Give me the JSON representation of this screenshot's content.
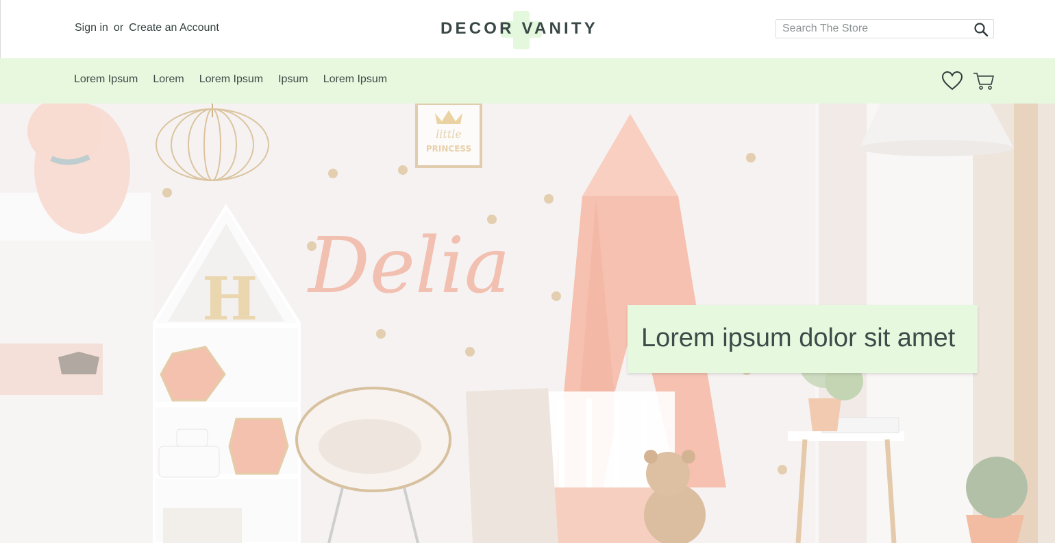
{
  "header": {
    "sign_in": "Sign in",
    "or": "or",
    "create_account": "Create an Account",
    "logo": "DECOR VANITY",
    "search_placeholder": "Search The Store"
  },
  "nav": {
    "items": [
      "Lorem Ipsum",
      "Lorem",
      "Lorem Ipsum",
      "Ipsum",
      "Lorem Ipsum"
    ],
    "icons": [
      "heart-icon",
      "cart-icon"
    ]
  },
  "hero": {
    "caption": "Lorem ipsum dolor sit amet",
    "wall_sign": "Delia",
    "frame_text_1": "little",
    "frame_text_2": "PRINCESS",
    "shelf_letter": "H"
  },
  "colors": {
    "accent_green": "#e7f8de",
    "text_dark": "#3b4a4a",
    "blush": "#f2b3a2",
    "gold": "#d9bf96"
  }
}
